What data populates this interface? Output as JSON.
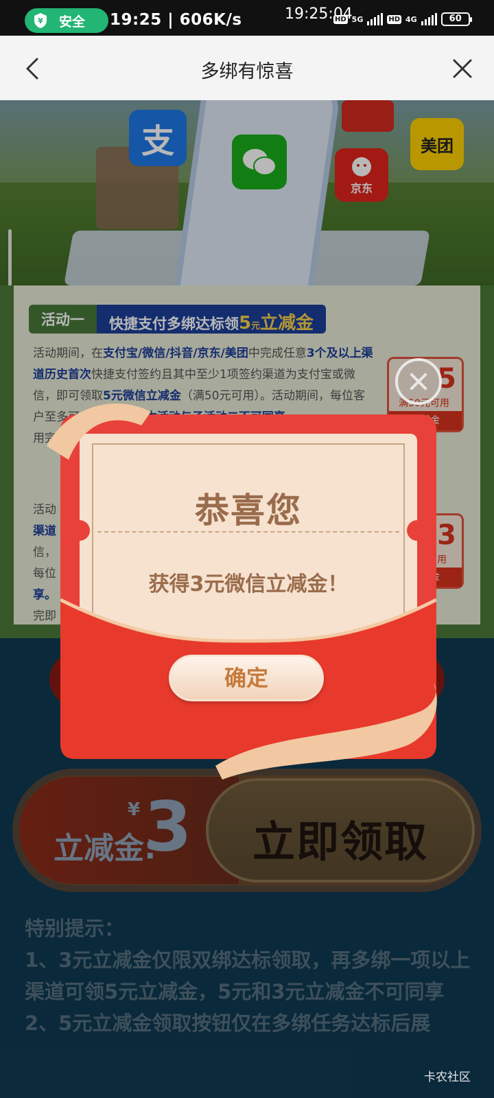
{
  "status_bar": {
    "safe_label": "安全",
    "left_text": "19:25 | 606K/s",
    "time": "19:25:04",
    "net1": "5G",
    "hd": "HD",
    "net2": "4G",
    "battery": "60"
  },
  "nav": {
    "title": "多绑有惊喜"
  },
  "hero": {
    "alipay_glyph": "支",
    "jd_label": "京东",
    "meituan_label": "美团"
  },
  "activity1": {
    "badge_left": "活动一",
    "badge_right_pre": "快捷支付多绑达标领",
    "badge_right_amount": "5",
    "badge_right_unit": "元",
    "badge_right_post": "立减金",
    "text_1": "活动期间，在",
    "text_channels": "支付宝/微信/抖音/京东/美团",
    "text_2": "中完成任意",
    "text_3plus": "3个及以上渠道历史首次",
    "text_3": "快捷支付签约且其中至少1项签约渠道为支付宝或微信，即可领取",
    "text_reward": "5元微信立减金",
    "text_4": "（满50元可用）。活动期间，每位客户至多可领取1次，",
    "text_excl": "且本活动与子活动二不可同享",
    "text_5": "，",
    "text_6": "用完"
  },
  "activity2": {
    "line1": "活动",
    "line2": "渠道",
    "line3": "信，",
    "line4": "每位",
    "line5": "享。",
    "line6": "完即"
  },
  "coupons": [
    {
      "amount": "5",
      "condition": "满50元可用",
      "name": "立减金"
    },
    {
      "amount": "3",
      "condition": "可用",
      "name": "立减金"
    }
  ],
  "claim": {
    "label": "立减金:",
    "yen": "¥",
    "amount": "3",
    "button": "立即领取"
  },
  "tips": {
    "title": "特别提示：",
    "line1": "1、3元立减金仅限双绑达标领取，再多绑一项以上渠道可领5元立减金，5元和3元立减金不可同享",
    "line2": "2、5元立减金领取按钮仅在多绑任务达标后展"
  },
  "modal": {
    "title": "恭喜您",
    "message": "获得3元微信立减金！",
    "confirm": "确定"
  },
  "watermark": "卡农社区"
}
